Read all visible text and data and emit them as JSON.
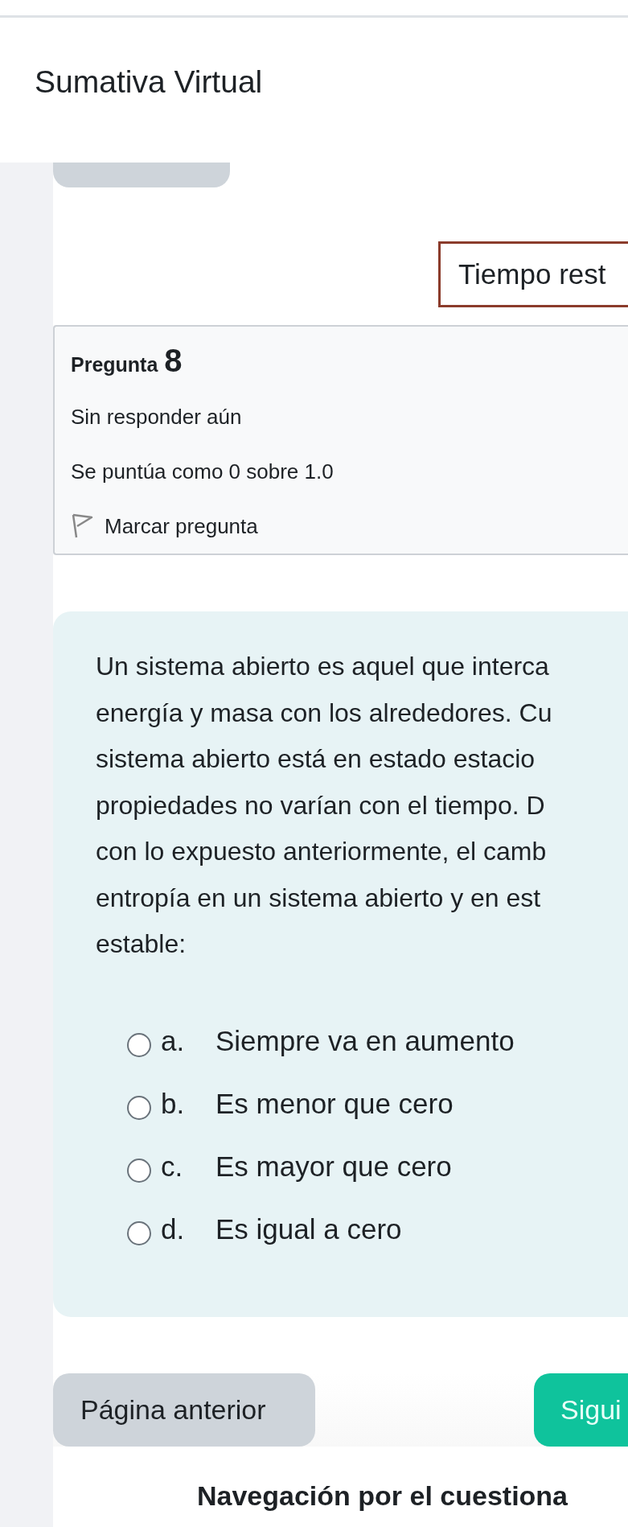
{
  "header": {
    "title": "Sumativa Virtual"
  },
  "timer": {
    "label": "Tiempo rest"
  },
  "question_info": {
    "label": "Pregunta",
    "number": "8",
    "status": "Sin responder aún",
    "grade": "Se puntúa como 0 sobre 1.0",
    "flag": {
      "label": "Marcar pregunta",
      "flagged": false
    }
  },
  "question": {
    "lines": [
      "Un sistema abierto es aquel que interca",
      "energía y masa con los alrededores. Cu",
      "sistema abierto está en estado estacio",
      "propiedades no varían con el tiempo. D",
      "con lo expuesto anteriormente, el camb",
      "entropía en un sistema abierto y en est",
      "estable:"
    ],
    "options": [
      {
        "letter": "a.",
        "text": "Siempre va en aumento",
        "selected": false
      },
      {
        "letter": "b.",
        "text": "Es menor que cero",
        "selected": false
      },
      {
        "letter": "c.",
        "text": "Es mayor que cero",
        "selected": false
      },
      {
        "letter": "d.",
        "text": "Es igual a cero",
        "selected": false
      }
    ]
  },
  "buttons": [
    {
      "kind": "secondary",
      "label": "Página anterior"
    },
    {
      "kind": "primary",
      "label": "Sigui"
    }
  ],
  "navigation": {
    "title": "Navegación por el cuestiona"
  }
}
